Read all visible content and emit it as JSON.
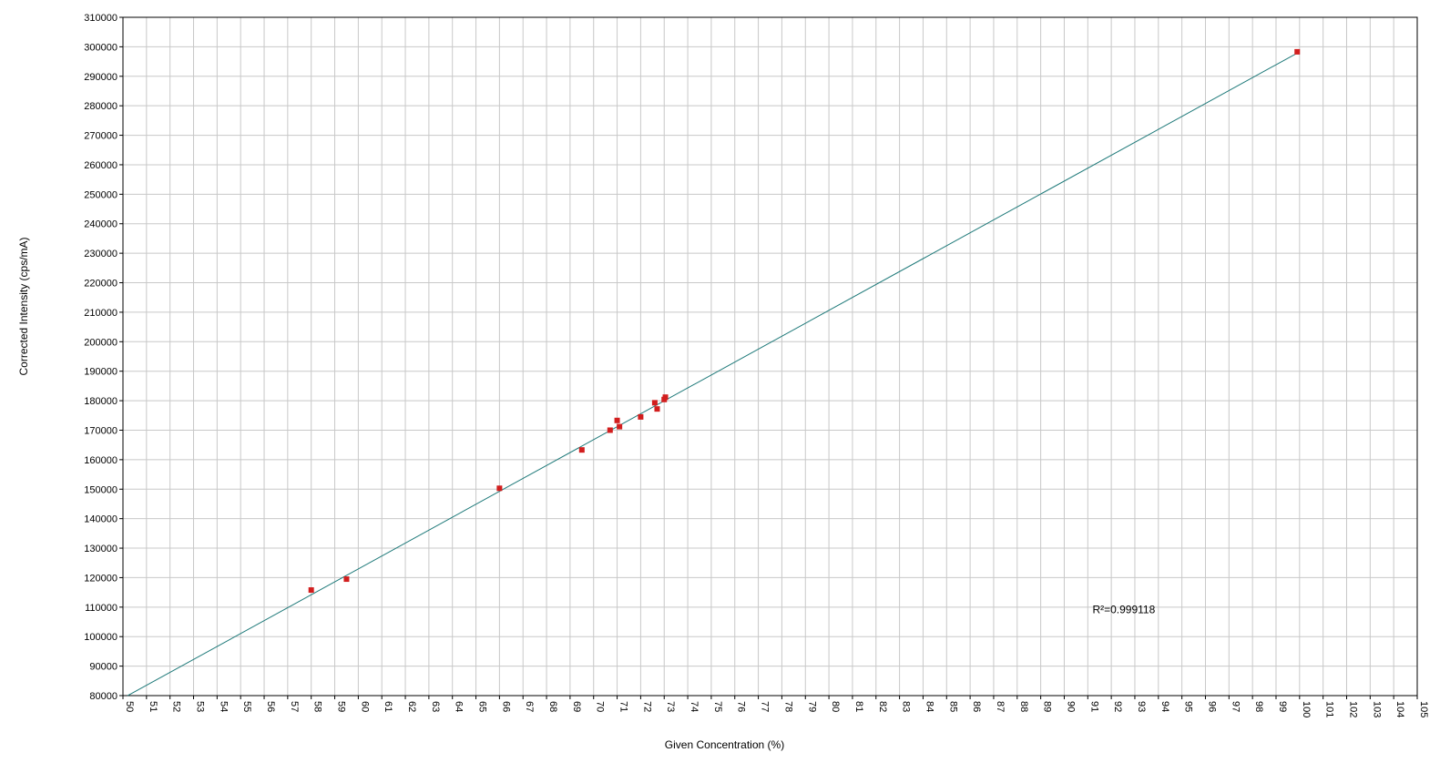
{
  "chart_data": {
    "type": "scatter",
    "title": "",
    "xlabel": "Given Concentration (%)",
    "ylabel": "Corrected Intensity (cps/mA)",
    "xlim": [
      50,
      105
    ],
    "ylim": [
      80000,
      310000
    ],
    "x_ticks": [
      50,
      51,
      52,
      53,
      54,
      55,
      56,
      57,
      58,
      59,
      60,
      61,
      62,
      63,
      64,
      65,
      66,
      67,
      68,
      69,
      70,
      71,
      72,
      73,
      74,
      75,
      76,
      77,
      78,
      79,
      80,
      81,
      82,
      83,
      84,
      85,
      86,
      87,
      88,
      89,
      90,
      91,
      92,
      93,
      94,
      95,
      96,
      97,
      98,
      99,
      100,
      101,
      102,
      103,
      104,
      105
    ],
    "y_ticks": [
      80000,
      90000,
      100000,
      110000,
      120000,
      130000,
      140000,
      150000,
      160000,
      170000,
      180000,
      190000,
      200000,
      210000,
      220000,
      230000,
      240000,
      250000,
      260000,
      270000,
      280000,
      290000,
      300000,
      310000
    ],
    "grid": true,
    "points": [
      {
        "x": 58.0,
        "y": 115800
      },
      {
        "x": 59.5,
        "y": 119500
      },
      {
        "x": 66.0,
        "y": 150300
      },
      {
        "x": 69.5,
        "y": 163300
      },
      {
        "x": 70.7,
        "y": 170000
      },
      {
        "x": 71.0,
        "y": 173300
      },
      {
        "x": 71.1,
        "y": 171200
      },
      {
        "x": 72.0,
        "y": 174500
      },
      {
        "x": 72.6,
        "y": 179300
      },
      {
        "x": 72.7,
        "y": 177200
      },
      {
        "x": 73.0,
        "y": 180400
      },
      {
        "x": 73.05,
        "y": 181200
      },
      {
        "x": 99.9,
        "y": 298300
      }
    ],
    "fit_line": {
      "x": [
        50.2,
        100.0
      ],
      "y": [
        80000,
        298300
      ]
    },
    "annotation": "R²=0.999118",
    "annotation_pos": {
      "x": 91.2,
      "y": 108000
    },
    "colors": {
      "point": "#d21e1e",
      "line": "#1f7a7a",
      "grid": "#c8c8c8",
      "axis": "#000000"
    }
  }
}
